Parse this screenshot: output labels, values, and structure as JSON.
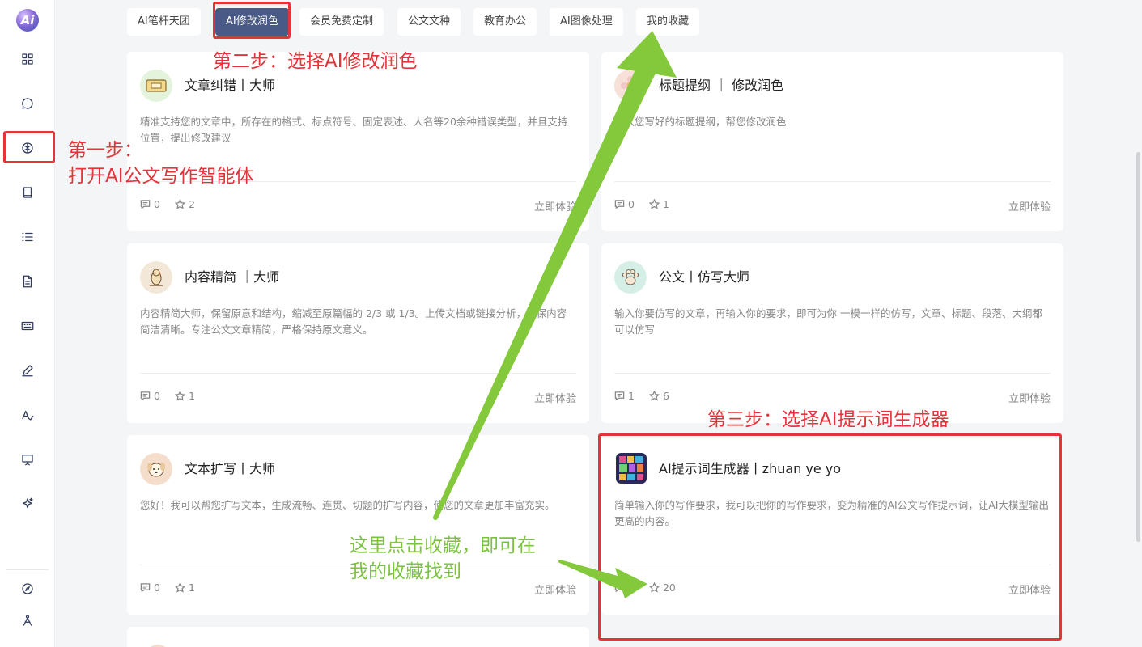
{
  "tabs": [
    {
      "label": "AI笔杆天团",
      "active": false
    },
    {
      "label": "AI修改润色",
      "active": true
    },
    {
      "label": "会员免费定制",
      "active": false
    },
    {
      "label": "公文文种",
      "active": false
    },
    {
      "label": "教育办公",
      "active": false
    },
    {
      "label": "AI图像处理",
      "active": false
    },
    {
      "label": "我的收藏",
      "active": false
    }
  ],
  "sidebar": {
    "logo_text": "Ai",
    "items": [
      {
        "icon": "grid-icon"
      },
      {
        "icon": "chat-bubble-icon"
      },
      {
        "icon": "brain-icon",
        "highlighted": true
      },
      {
        "icon": "book-icon"
      },
      {
        "icon": "list-icon"
      },
      {
        "icon": "document-icon"
      },
      {
        "icon": "keyboard-icon"
      },
      {
        "icon": "pen-icon"
      },
      {
        "icon": "text-format-icon"
      },
      {
        "icon": "presentation-icon"
      },
      {
        "icon": "sparkle-icon"
      }
    ],
    "bottom_items": [
      {
        "icon": "compass-icon"
      },
      {
        "icon": "drafting-compass-icon"
      }
    ]
  },
  "cards": [
    {
      "title": "文章纠错丨大师",
      "desc": "精准支持您的文章中，所存在的格式、标点符号、固定表述、人名等20余种错误类型，并且支持位置，提出修改建议",
      "comments": "0",
      "stars": "2",
      "action": "立即体验",
      "avatar": "ticket-icon"
    },
    {
      "title": "标题提纲 ｜ 修改润色",
      "desc": "输入您写好的标题提纲，帮您修改润色",
      "comments": "0",
      "stars": "1",
      "action": "立即体验",
      "avatar": "flower-icon"
    },
    {
      "title": "内容精简 ｜大师",
      "desc": "内容精简大师，保留原意和结构，缩减至原篇幅的 2/3 或 1/3。上传文档或链接分析，确保内容简洁清晰。专注公文文章精简，严格保持原文意义。",
      "comments": "0",
      "stars": "1",
      "action": "立即体验",
      "avatar": "bird-icon"
    },
    {
      "title": "公文丨仿写大师",
      "desc": "输入你要仿写的文章，再输入你的要求，即可为你 一模一样的仿写，文章、标题、段落、大纲都可以仿写",
      "comments": "1",
      "stars": "6",
      "action": "立即体验",
      "avatar": "paw-icon"
    },
    {
      "title": "文本扩写丨大师",
      "desc": "您好！我可以帮您扩写文本，生成流畅、连贯、切题的扩写内容，使您的文章更加丰富充实。",
      "comments": "0",
      "stars": "1",
      "action": "立即体验",
      "avatar": "dog-icon"
    },
    {
      "title": "AI提示词生成器丨zhuan ye yo",
      "desc": "简单输入你的写作要求，我可以把你的写作要求，变为精准的AI公文写作提示词，让AI大模型输出更高的内容。",
      "comments": "1",
      "stars": "20",
      "action": "立即体验",
      "avatar": "mosaic-icon"
    }
  ],
  "annotations": {
    "step1_line1": "第一步：",
    "step1_line2": "打开AI公文写作智能体",
    "step2": "第二步：选择AI修改润色",
    "step3": "第三步：选择AI提示词生成器",
    "collect_line1": "这里点击收藏，即可在",
    "collect_line2": "我的收藏找到"
  },
  "colors": {
    "annotation_red": "#e5333b",
    "annotation_green": "#7cc242",
    "active_tab": "#4a5a86"
  }
}
